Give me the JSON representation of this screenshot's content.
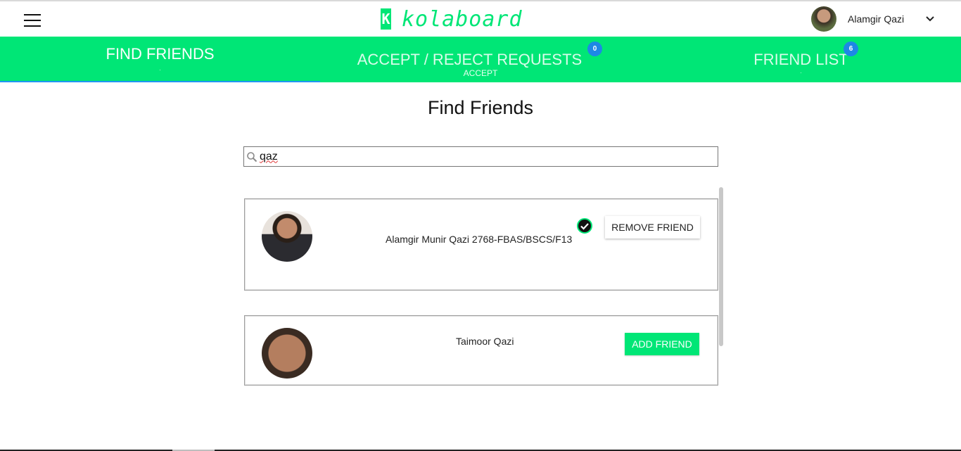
{
  "header": {
    "logo_mark": "K",
    "logo_text": "kolaboard",
    "user_name": "Alamgir Qazi"
  },
  "tabs": [
    {
      "label": "FIND FRIENDS",
      "sub": ".",
      "badge": ""
    },
    {
      "label": "ACCEPT / REJECT REQUESTS",
      "sub": "ACCEPT",
      "badge": "0"
    },
    {
      "label": "FRIEND LIST",
      "sub": ".",
      "badge": "6"
    }
  ],
  "main": {
    "title": "Find Friends",
    "search": {
      "value": "qaz",
      "placeholder": ""
    }
  },
  "results": [
    {
      "name": "Alamgir Munir Qazi 2768-FBAS/BSCS/F13",
      "is_friend": true,
      "action_label": "REMOVE FRIEND"
    },
    {
      "name": "Taimoor Qazi",
      "is_friend": false,
      "action_label": "ADD FRIEND"
    }
  ],
  "colors": {
    "brand_green": "#00e676",
    "badge_blue": "#1e88e5",
    "active_tab_indicator": "#2196f3"
  }
}
